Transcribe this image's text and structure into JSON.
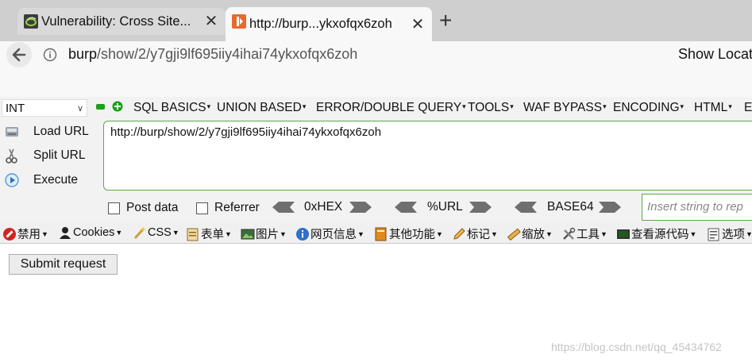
{
  "tabs": [
    {
      "title": "Vulnerability: Cross Site...",
      "favicon": "dvwa-favicon",
      "active": false
    },
    {
      "title": "http://burp...ykxofqx6zoh",
      "favicon": "burp-favicon",
      "active": true
    }
  ],
  "new_tab_symbol": "+",
  "close_symbol": "✕",
  "url": {
    "host": "burp",
    "path": "/show/2/y7gji9lf695iiy4ihai74ykxofqx6zoh"
  },
  "show_location": "Show Locat",
  "hackbar": {
    "type_select": "INT",
    "menus": [
      {
        "label": "SQL BASICS"
      },
      {
        "label": "UNION BASED"
      },
      {
        "label": "ERROR/DOUBLE QUERY"
      },
      {
        "label": "TOOLS"
      },
      {
        "label": "WAF BYPASS"
      },
      {
        "label": "ENCODING"
      },
      {
        "label": "HTML"
      },
      {
        "label": "EN"
      }
    ],
    "load_url": "Load URL",
    "split_url": "Split URL",
    "execute": "Execute",
    "url_value": "http://burp/show/2/y7gji9lf695iiy4ihai74ykxofqx6zoh",
    "post_data": "Post data",
    "referrer": "Referrer",
    "hex": "0xHEX",
    "urlenc": "%URL",
    "base64": "BASE64",
    "insert_placeholder": "Insert string to rep"
  },
  "cn_toolbar": [
    {
      "label": "禁用",
      "icon": "block-icon"
    },
    {
      "label": "Cookies",
      "icon": "person-icon"
    },
    {
      "label": "CSS",
      "icon": "wand-icon"
    },
    {
      "label": "表单",
      "icon": "form-icon"
    },
    {
      "label": "图片",
      "icon": "image-icon"
    },
    {
      "label": "网页信息",
      "icon": "info-icon"
    },
    {
      "label": "其他功能",
      "icon": "misc-icon"
    },
    {
      "label": "标记",
      "icon": "pencil-icon"
    },
    {
      "label": "缩放",
      "icon": "ruler-icon"
    },
    {
      "label": "工具",
      "icon": "tools-icon"
    },
    {
      "label": "查看源代码",
      "icon": "source-icon"
    },
    {
      "label": "选项",
      "icon": "options-icon"
    }
  ],
  "page": {
    "submit_label": "Submit request"
  },
  "watermark": "https://blog.csdn.net/qq_45434762",
  "colors": {
    "accent_green": "#5aa84c",
    "burp_orange": "#e8692c"
  }
}
